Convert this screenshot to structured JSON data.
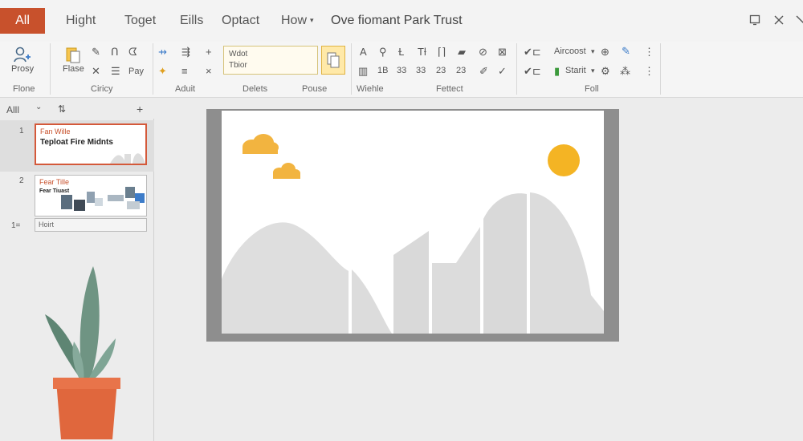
{
  "tabs": {
    "active": "All",
    "items": [
      {
        "label": "Hight",
        "caret": "▾"
      },
      {
        "label": "Toget",
        "caret": ""
      },
      {
        "label": "Eills",
        "caret": ""
      },
      {
        "label": "Optact",
        "caret": ""
      },
      {
        "label": "How",
        "caret": "▾"
      }
    ]
  },
  "document": {
    "title": "Ove fiomant Park Trust"
  },
  "ribbon": {
    "proxy_label": "Prosy",
    "flone_label": "Flone",
    "flase_label": "Flase",
    "pay_label": "Pay",
    "ciricy_label": "Ciricy",
    "text_box_line1": "Wdot",
    "text_box_line2": "Tbior",
    "aduit_label": "Aduit",
    "delets_label": "Delets",
    "pouse_label": "Pouse",
    "wiehle_label": "Wiehle",
    "fettect_label": "Fettect",
    "foll_label": "Foll",
    "aircoost_label": "Aircoost",
    "starit_label": "Starit",
    "num_1": "1B",
    "num_2": "33",
    "num_3": "33",
    "num_4": "23",
    "num_5": "23"
  },
  "outline": {
    "view_label": "Alll"
  },
  "slides": [
    {
      "number": "1",
      "subtitle": "Fan Wille",
      "title": "Teploat Fire Midnts"
    },
    {
      "number": "2",
      "subtitle": "Fear Tille",
      "title": "Fear Tiuast"
    }
  ],
  "outline_item": {
    "number": "1=",
    "label": "Hoirt"
  },
  "colors": {
    "accent": "#c8512c",
    "cloud": "#f2b440",
    "sun": "#f4b424",
    "mountain": "#dedede",
    "slide_frame": "#8e8e8e",
    "plant_leaf": "#6f9483",
    "pot": "#e0673d"
  }
}
